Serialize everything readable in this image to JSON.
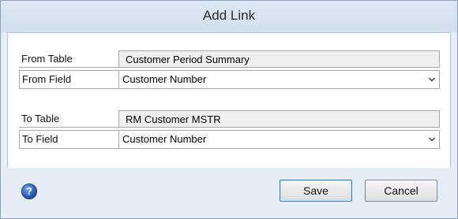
{
  "dialog": {
    "title": "Add Link"
  },
  "from": {
    "table_label": "From Table",
    "table_value": "Customer Period Summary",
    "field_label": "From Field",
    "field_value": "Customer Number"
  },
  "to": {
    "table_label": "To Table",
    "table_value": "RM Customer MSTR",
    "field_label": "To Field",
    "field_value": "Customer Number"
  },
  "buttons": {
    "save": "Save",
    "cancel": "Cancel",
    "help": "?"
  },
  "icons": {
    "help": "help-icon",
    "dropdown": "chevron-down-icon"
  },
  "colors": {
    "window_bg": "#e6edf6",
    "readonly_bg": "#efefef",
    "default_button_border": "#3c7fb1"
  }
}
